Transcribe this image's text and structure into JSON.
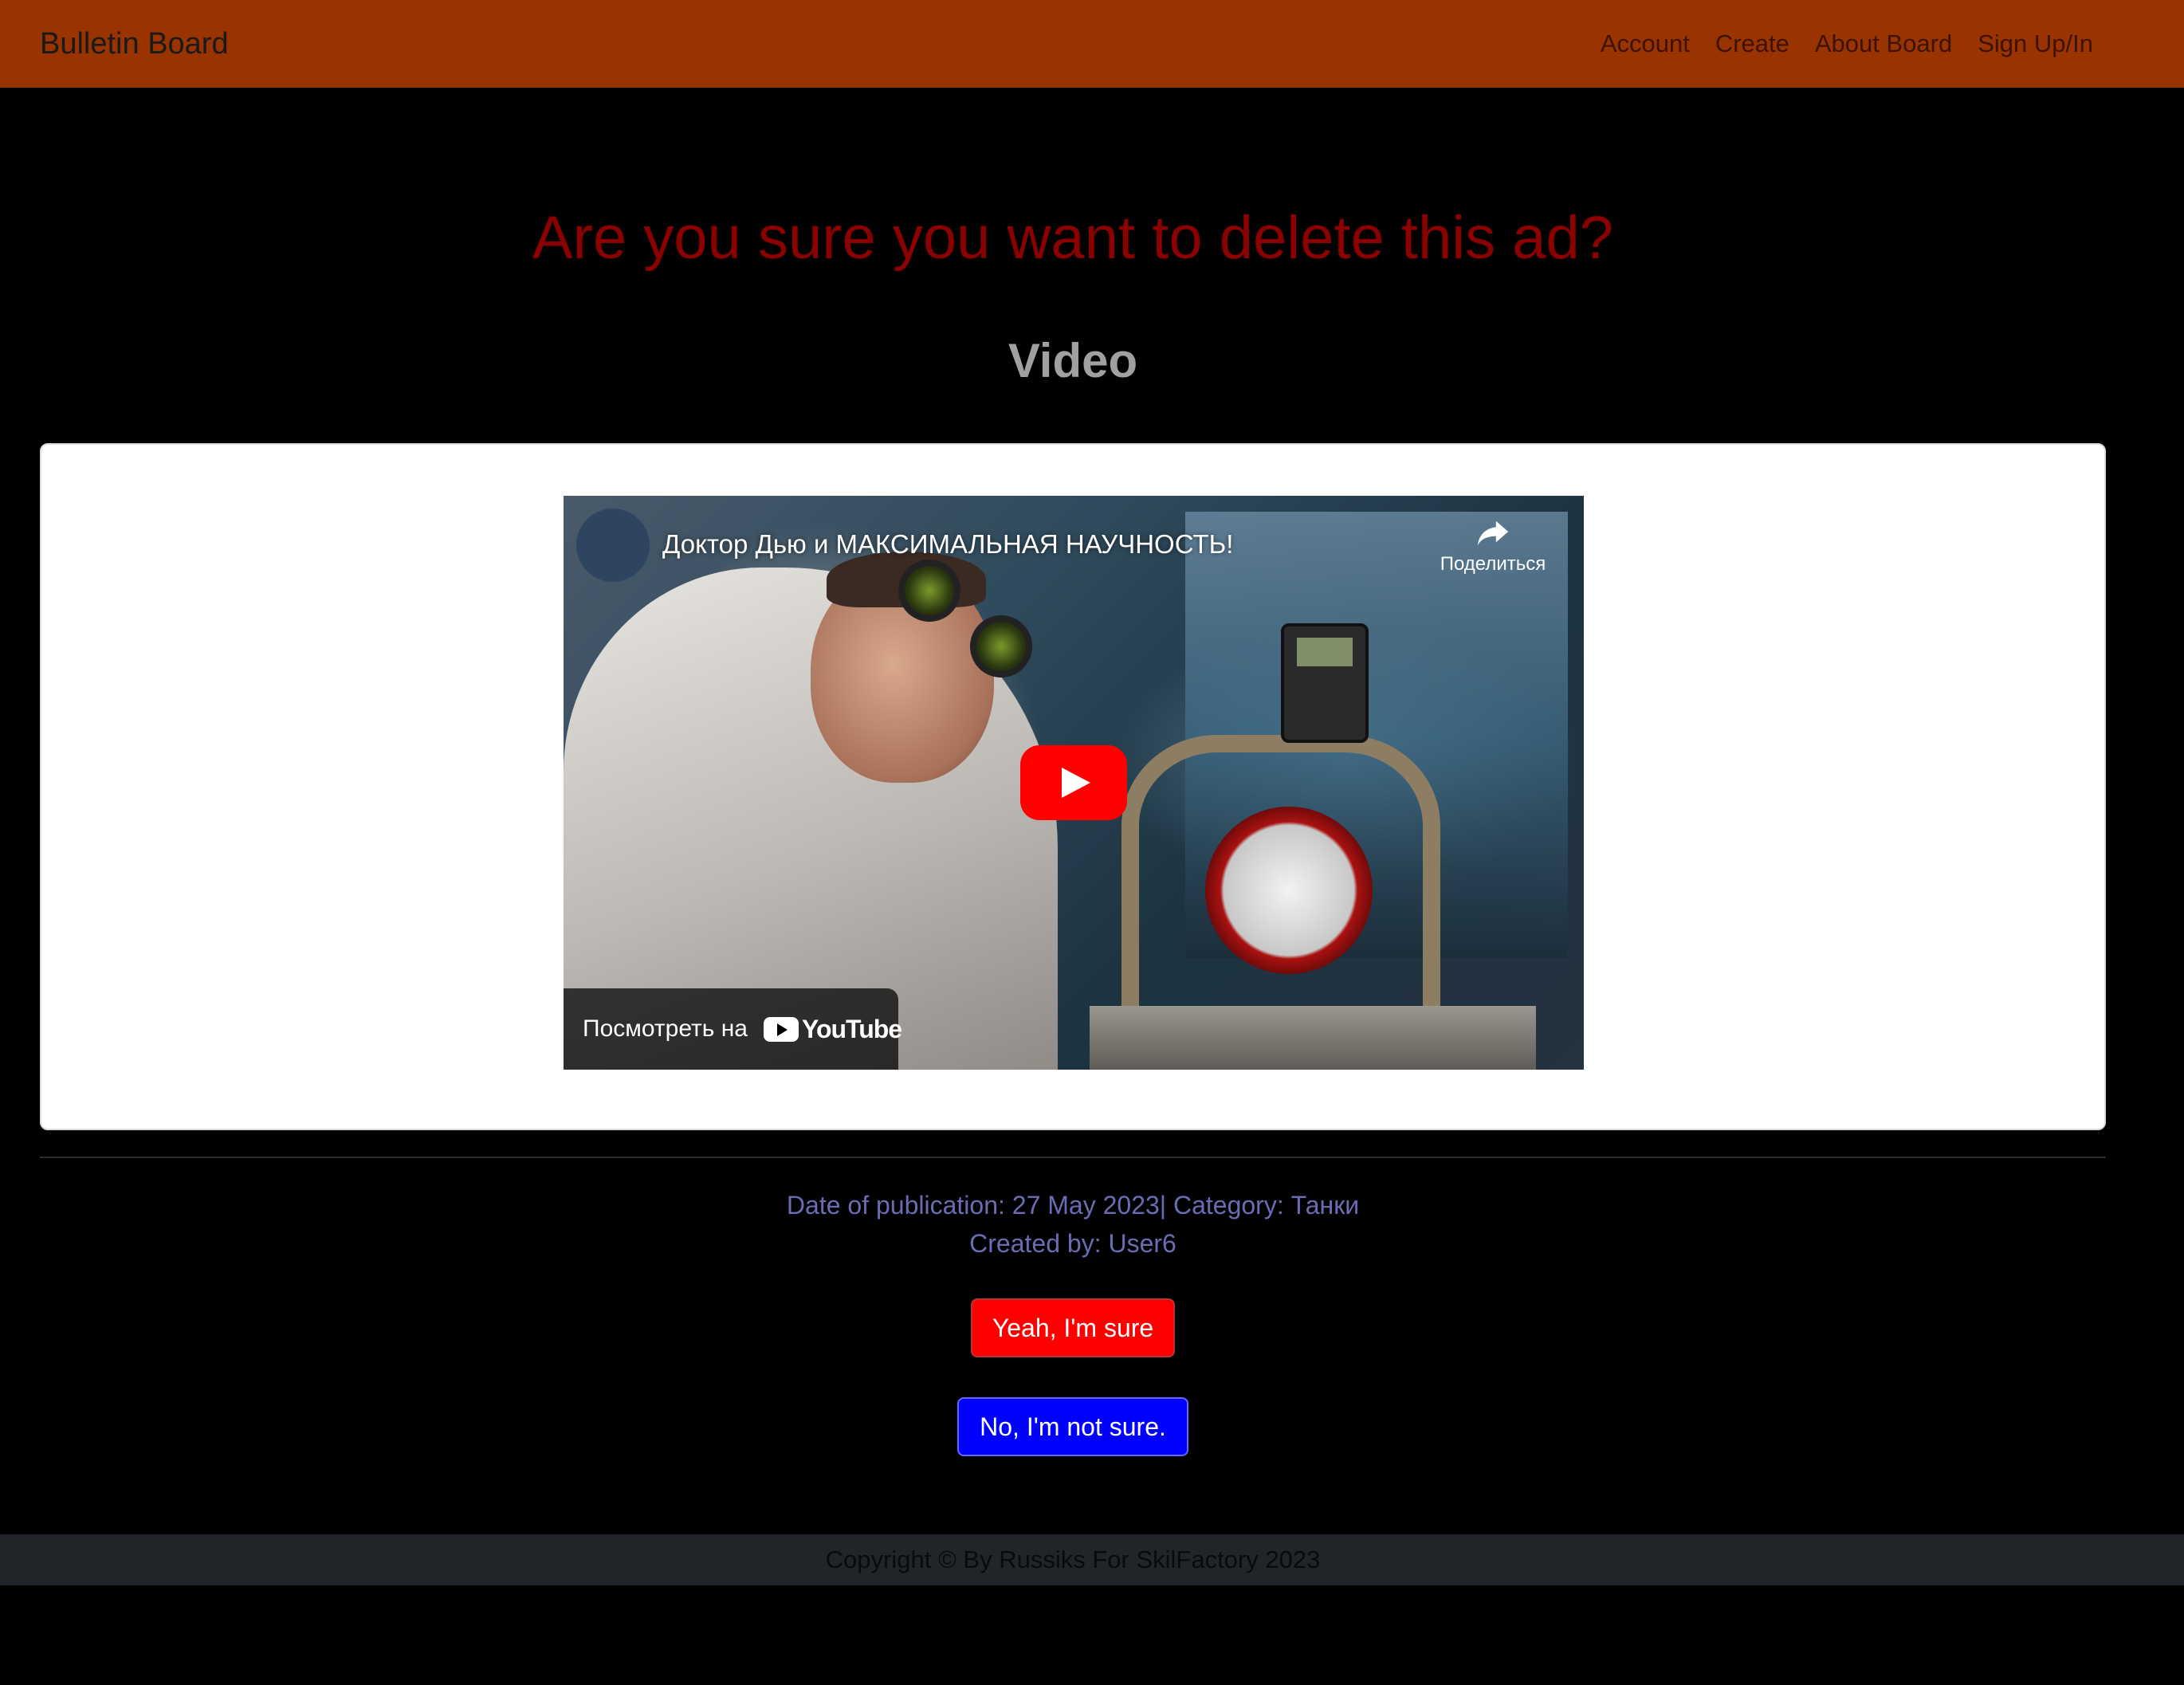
{
  "navbar": {
    "brand": "Bulletin Board",
    "links": [
      "Account",
      "Create",
      "About Board",
      "Sign Up/In"
    ],
    "background": "#993300"
  },
  "page": {
    "title": "Are you sure you want to delete this ad?",
    "section_title": "Video",
    "title_color": "#8b0000"
  },
  "video": {
    "title": "Доктор Дью и МАКСИМАЛЬНАЯ НАУЧНОСТЬ!",
    "share_label": "Поделиться",
    "watch_on": "Посмотреть на",
    "platform": "YouTube",
    "icons": [
      "share-icon",
      "play-icon",
      "youtube-logo-icon"
    ]
  },
  "meta": {
    "line1": "Date of publication: 27 May 2023| Category: Танки",
    "line2": "Created by: User6"
  },
  "actions": {
    "confirm_label": "Yeah, I'm sure",
    "cancel_label": "No, I'm not sure.",
    "confirm_color": "#ff0000",
    "cancel_color": "#0000ff"
  },
  "footer": {
    "text": "Copyright © By Russiks For SkilFactory 2023"
  }
}
